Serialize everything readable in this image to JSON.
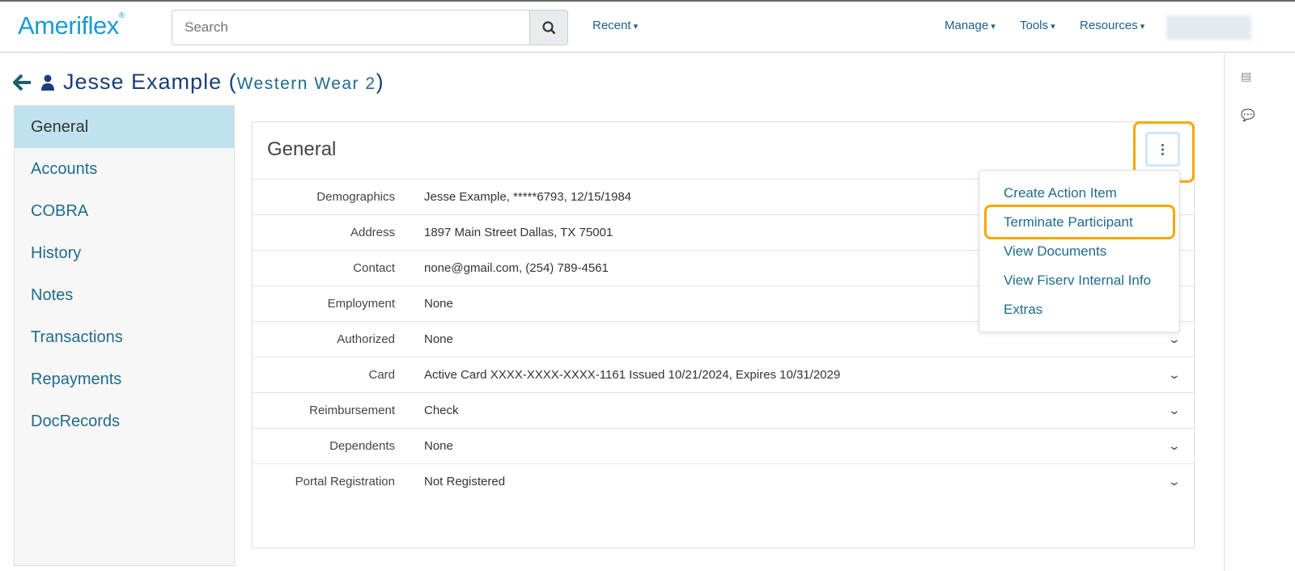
{
  "header": {
    "logo": "Ameriflex",
    "logo_mark": "®",
    "search_placeholder": "Search",
    "nav": [
      "Recent",
      "Manage",
      "Tools",
      "Resources"
    ]
  },
  "title": {
    "name": "Jesse Example",
    "open": "(",
    "company": "Western Wear 2",
    "close": ")"
  },
  "sidebar": {
    "items": [
      "General",
      "Accounts",
      "COBRA",
      "History",
      "Notes",
      "Transactions",
      "Repayments",
      "DocRecords"
    ]
  },
  "card": {
    "title": "General",
    "rows": [
      {
        "label": "Demographics",
        "value": "Jesse Example, *****6793, 12/15/1984"
      },
      {
        "label": "Address",
        "value": "1897 Main Street Dallas, TX 75001"
      },
      {
        "label": "Contact",
        "value": "none@gmail.com, (254) 789-4561"
      },
      {
        "label": "Employment",
        "value": "None"
      },
      {
        "label": "Authorized",
        "value": "None"
      },
      {
        "label": "Card",
        "value": "Active Card XXXX-XXXX-XXXX-1161 Issued 10/21/2024, Expires 10/31/2029"
      },
      {
        "label": "Reimbursement",
        "value": "Check"
      },
      {
        "label": "Dependents",
        "value": "None"
      },
      {
        "label": "Portal Registration",
        "value": "Not Registered"
      }
    ]
  },
  "menu": {
    "items": [
      "Create Action Item",
      "Terminate Participant",
      "View Documents",
      "View Fiserv Internal Info",
      "Extras"
    ]
  }
}
